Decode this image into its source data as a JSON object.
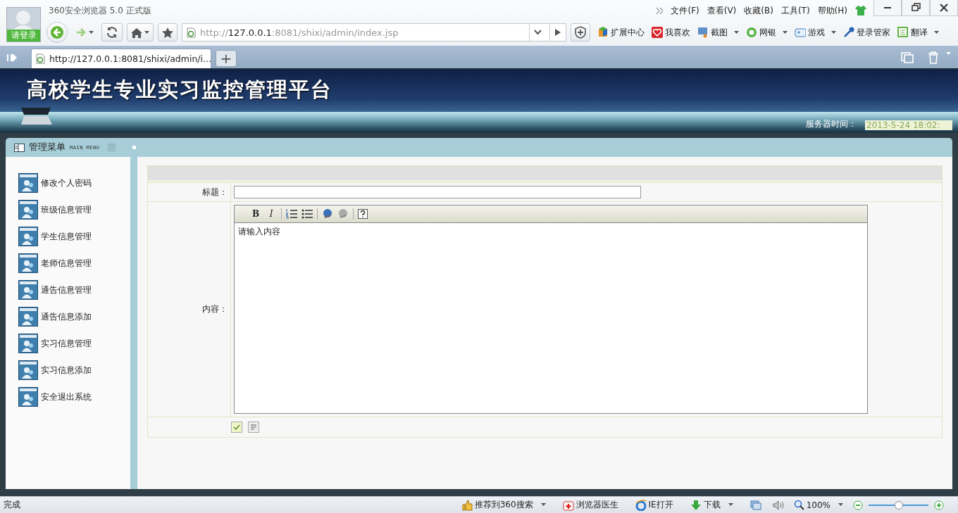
{
  "browser": {
    "login": "请登录",
    "title": "360安全浏览器 5.0 正式版",
    "menu": [
      "文件(F)",
      "查看(V)",
      "收藏(B)",
      "工具(T)",
      "帮助(H)"
    ],
    "address": {
      "scheme": "http://",
      "host": "127.0.0.1",
      "rest": ":8081/shixi/admin/index.jsp"
    },
    "toolbar": [
      {
        "label": "扩展中心",
        "dropdown": false
      },
      {
        "label": "我喜欢",
        "dropdown": false
      },
      {
        "label": "截图",
        "dropdown": true
      },
      {
        "label": "网银",
        "dropdown": true
      },
      {
        "label": "游戏",
        "dropdown": true
      },
      {
        "label": "登录管家",
        "dropdown": false
      },
      {
        "label": "翻译",
        "dropdown": true
      }
    ],
    "tabs": [
      {
        "label": "http://127.0.0.1:8081/shixi/admin/i...",
        "selected": true
      }
    ],
    "new_tab": "+"
  },
  "page": {
    "title": "高校学生专业实习监控管理平台",
    "server_time_label": "服务器时间：",
    "server_time": "2013-5-24 18:02:",
    "menu": {
      "title": "管理菜单",
      "subtitle": "MAIN MENU",
      "items": [
        {
          "label": "修改个人密码"
        },
        {
          "label": "班级信息管理"
        },
        {
          "label": "学生信息管理"
        },
        {
          "label": "老师信息管理"
        },
        {
          "label": "通告信息管理"
        },
        {
          "label": "通告信息添加"
        },
        {
          "label": "实习信息管理"
        },
        {
          "label": "实习信息添加"
        },
        {
          "label": "安全退出系统"
        }
      ]
    },
    "form": {
      "fields": [
        {
          "kind": "input",
          "label": "标题："
        },
        {
          "kind": "editor",
          "label": "内容：",
          "toolbar": [
            "B",
            "I"
          ],
          "value": "请输入内容"
        }
      ]
    }
  },
  "status_bar": {
    "text": "完成",
    "items": [
      {
        "label": "推荐到360搜索",
        "dropdown": true
      },
      {
        "label": "浏览器医生",
        "dropdown": false
      },
      {
        "label": "IE打开",
        "dropdown": false
      },
      {
        "label": "下载",
        "dropdown": true
      }
    ],
    "zoom": {
      "label": "100%",
      "level": 0.5
    }
  }
}
